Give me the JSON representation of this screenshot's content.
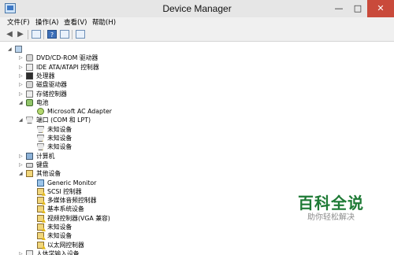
{
  "window": {
    "title": "Device Manager",
    "controls": {
      "minimize": "—",
      "maximize": "□",
      "close": "✕"
    }
  },
  "menu": {
    "items": [
      "文件(F)",
      "操作(A)",
      "查看(V)",
      "帮助(H)"
    ]
  },
  "toolbar": {
    "buttons": [
      "back-arrow-icon",
      "forward-arrow-icon",
      "properties-icon",
      "help-icon",
      "scan-icon"
    ]
  },
  "tree": {
    "rows": [
      {
        "label": "",
        "indent": 0,
        "expanded": true,
        "icon": "computer-icon"
      },
      {
        "label": "DVD/CD-ROM 驱动器",
        "indent": 1,
        "expanded": false,
        "icon": "disk-icon"
      },
      {
        "label": "IDE ATA/ATAPI 控制器",
        "indent": 1,
        "expanded": false,
        "icon": "storage-icon"
      },
      {
        "label": "处理器",
        "indent": 1,
        "expanded": false,
        "icon": "cpu-icon"
      },
      {
        "label": "磁盘驱动器",
        "indent": 1,
        "expanded": false,
        "icon": "disk-icon"
      },
      {
        "label": "存储控制器",
        "indent": 1,
        "expanded": false,
        "icon": "storage-icon"
      },
      {
        "label": "电池",
        "indent": 1,
        "expanded": true,
        "icon": "battery-icon"
      },
      {
        "label": "Microsoft AC Adapter",
        "indent": 2,
        "expanded": null,
        "icon": "ac-adapter-icon"
      },
      {
        "label": "端口 (COM 和 LPT)",
        "indent": 1,
        "expanded": true,
        "icon": "port-icon"
      },
      {
        "label": "未知设备",
        "indent": 2,
        "expanded": null,
        "icon": "port-warning-icon"
      },
      {
        "label": "未知设备",
        "indent": 2,
        "expanded": null,
        "icon": "port-warning-icon"
      },
      {
        "label": "未知设备",
        "indent": 2,
        "expanded": null,
        "icon": "port-warning-icon"
      },
      {
        "label": "计算机",
        "indent": 1,
        "expanded": false,
        "icon": "monitor-icon"
      },
      {
        "label": "键盘",
        "indent": 1,
        "expanded": false,
        "icon": "keyboard-icon"
      },
      {
        "label": "其他设备",
        "indent": 1,
        "expanded": true,
        "icon": "other-devices-icon"
      },
      {
        "label": "Generic Monitor",
        "indent": 2,
        "expanded": null,
        "icon": "generic-monitor-icon"
      },
      {
        "label": "SCSI 控制器",
        "indent": 2,
        "expanded": null,
        "icon": "unknown-warning-icon"
      },
      {
        "label": "多媒体音频控制器",
        "indent": 2,
        "expanded": null,
        "icon": "unknown-warning-icon"
      },
      {
        "label": "基本系统设备",
        "indent": 2,
        "expanded": null,
        "icon": "unknown-warning-icon"
      },
      {
        "label": "视频控制器(VGA 兼容)",
        "indent": 2,
        "expanded": null,
        "icon": "unknown-warning-icon"
      },
      {
        "label": "未知设备",
        "indent": 2,
        "expanded": null,
        "icon": "unknown-warning-icon"
      },
      {
        "label": "未知设备",
        "indent": 2,
        "expanded": null,
        "icon": "unknown-warning-icon"
      },
      {
        "label": "以太网控制器",
        "indent": 2,
        "expanded": null,
        "icon": "unknown-warning-icon"
      },
      {
        "label": "人体学输入设备",
        "indent": 1,
        "expanded": false,
        "icon": "hid-icon"
      }
    ]
  },
  "watermark": {
    "title": "百科全说",
    "subtitle": "助你轻松解决"
  },
  "colors": {
    "titlebar": "#e6e6e6",
    "close_button": "#c94a3b",
    "watermark_green": "#1e7a35"
  }
}
